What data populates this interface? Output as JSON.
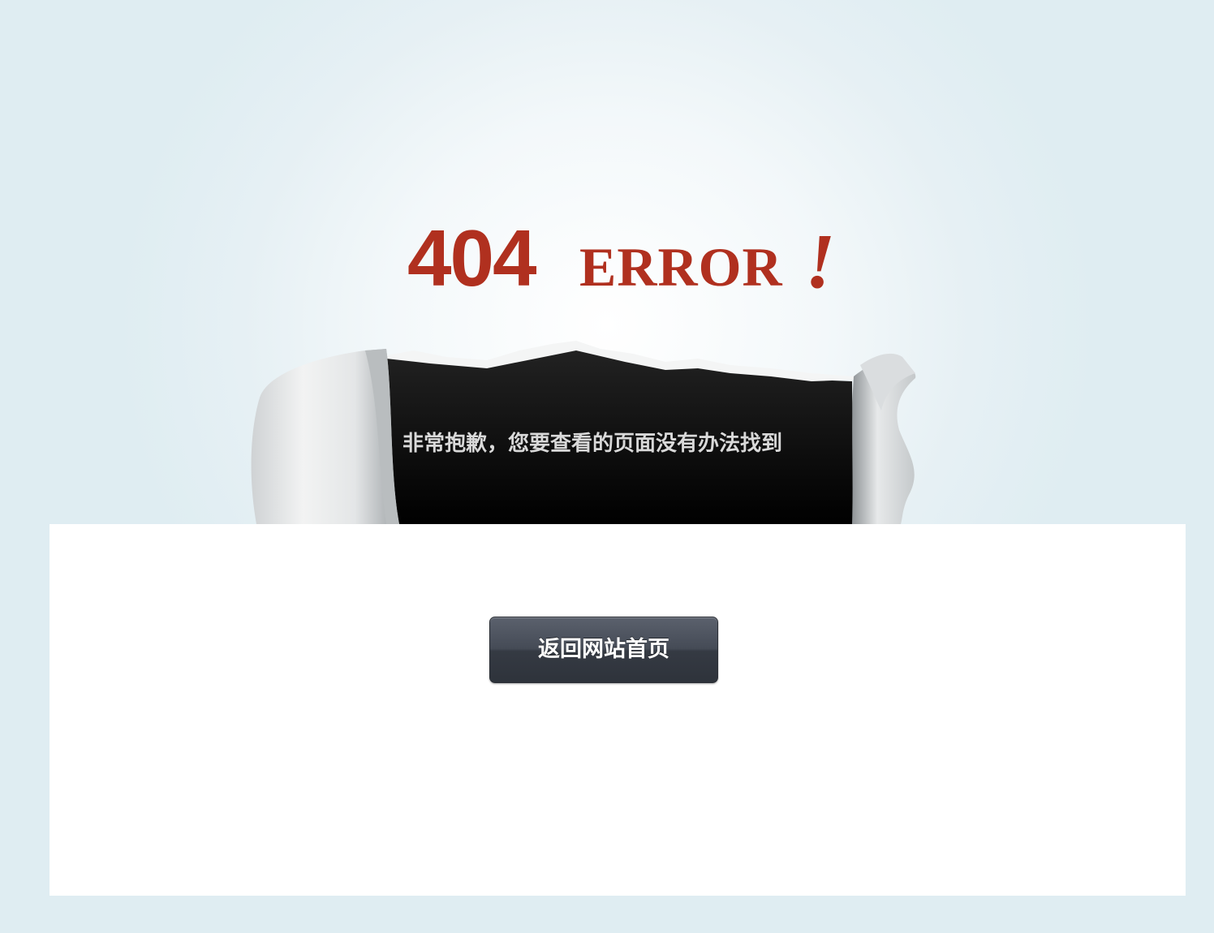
{
  "hero": {
    "error_code": "404",
    "error_word": "ERROR",
    "exclaim": "!",
    "message": "非常抱歉，您要查看的页面没有办法找到"
  },
  "content": {
    "home_button_label": "返回网站首页"
  },
  "colors": {
    "background": "#dfedf2",
    "headline_red": "#b0301f",
    "panel_black": "#000000",
    "button_dark": "#3b4049",
    "card_white": "#ffffff"
  }
}
